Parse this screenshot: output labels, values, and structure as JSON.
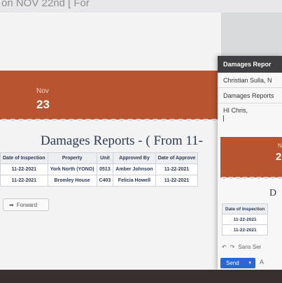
{
  "header": {
    "partial_text": "on NOV 22nd [ For"
  },
  "email": {
    "banner": {
      "month": "Nov",
      "day": "23"
    },
    "title": "Damages Reports - ( From 11-",
    "table": {
      "columns": [
        "Date of Inspection",
        "Property",
        "Unit",
        "Approved By",
        "Date of Approve"
      ],
      "rows": [
        [
          "11-22-2021",
          "York North (YONO)",
          "0513",
          "Amber Johnson",
          "11-22-2021"
        ],
        [
          "11-22-2021",
          "Bromley House",
          "C403",
          "Felicia Howell",
          "11-22-2021"
        ]
      ]
    },
    "forward_label": "Forward"
  },
  "compose": {
    "title": "Damages Repor",
    "to": "Christian Sulla, N",
    "subject": "Damages Reports",
    "body": "HI Chris,",
    "banner": {
      "month": "N",
      "day": "2"
    },
    "title_partial": "D",
    "table": {
      "columns": [
        "Date of Inspection"
      ],
      "rows": [
        [
          "11-22-2021"
        ],
        [
          "11-22-2021"
        ]
      ]
    },
    "font_label": "Sans Ser",
    "send_label": "Send"
  },
  "colors": {
    "accent": "#b8542f",
    "navy": "#2b3a55",
    "send": "#2a66d4"
  }
}
